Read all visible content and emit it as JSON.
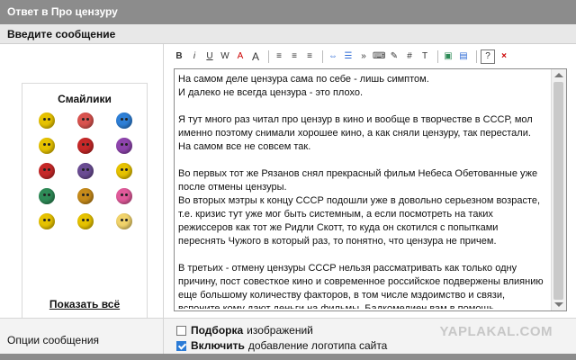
{
  "header": {
    "title": "Ответ в Про цензуру"
  },
  "subheader": {
    "label": "Введите сообщение"
  },
  "smileys": {
    "title": "Смайлики",
    "show_all": "Показать всё",
    "items": [
      {
        "icon": "cool-smiley-icon",
        "color": "#e6c200"
      },
      {
        "icon": "love-smiley-icon",
        "color": "#d9534f"
      },
      {
        "icon": "blue-smiley-icon",
        "color": "#2e7fd6"
      },
      {
        "icon": "thinking-smiley-icon",
        "color": "#e6c200"
      },
      {
        "icon": "red-smiley-icon",
        "color": "#c62828"
      },
      {
        "icon": "purple-smiley-icon",
        "color": "#8e44ad"
      },
      {
        "icon": "gun-smiley-icon",
        "color": "#c62828"
      },
      {
        "icon": "dark-smiley-icon",
        "color": "#6a4c93"
      },
      {
        "icon": "crazy-smiley-icon",
        "color": "#e6c200"
      },
      {
        "icon": "green-smiley-icon",
        "color": "#2e8b57"
      },
      {
        "icon": "book-smiley-icon",
        "color": "#c68a1a"
      },
      {
        "icon": "pink-smiley-icon",
        "color": "#e05a9a"
      },
      {
        "icon": "medal-smiley-icon",
        "color": "#e6c200"
      },
      {
        "icon": "laugh-smiley-icon",
        "color": "#e6c200"
      },
      {
        "icon": "star-smiley-icon",
        "color": "#f1d36b"
      }
    ]
  },
  "toolbar": {
    "bold": "B",
    "italic": "i",
    "underline": "U",
    "strike": "W",
    "color": "A",
    "size": "A",
    "align_left": "≡",
    "align_center": "≡",
    "align_right": "≡",
    "link": "⇔",
    "list": "☰",
    "quote": "»",
    "code": "⌨",
    "edit": "✎",
    "hash": "#",
    "text": "T",
    "image": "▣",
    "video": "▤",
    "help": "?",
    "close": "×"
  },
  "editor": {
    "paragraphs": [
      "На самом деле цензура сама по себе - лишь симптом.\nИ далеко не всегда цензура - это плохо.",
      "Я тут много раз читал про цензур в кино и вообще в творчестве в СССР, мол именно поэтому снимали хорошее кино, а как сняли цензуру, так перестали.\nНа самом все не совсем так.",
      "Во первых тот же Рязанов снял прекрасный фильм Небеса Обетованные уже после отмены цензуры.\nВо вторых мэтры к концу СССР подошли уже в довольно серьезном возрасте, т.е. кризис тут уже мог быть системным, а если посмотреть на таких режиссеров как тот же Ридли Скотт, то куда он скотился с попытками переснять Чужого в который раз, то понятно, что цензура не причем.",
      "В третьих - отмену цензуры СССР нельзя рассматривать как только одну причину, пост совесткое кино и современное российское подвержены влиянию еще большому количеству факторов, в том числе мздоимство и связи, вспоните кому дают деньги на фильмы, Бадкомедиен вам в помощь.\nПри этом отличные фильмы тоже снимали, например Питер ФМ. День Выборов."
    ]
  },
  "options": {
    "label": "Опции сообщения",
    "opt1_bold": "Подборка",
    "opt1_text": "изображений",
    "opt1_checked": false,
    "opt2_bold": "Включить",
    "opt2_text": "добавление логотипа сайта",
    "opt2_checked": true
  },
  "watermark": "YAPLAKAL.COM"
}
